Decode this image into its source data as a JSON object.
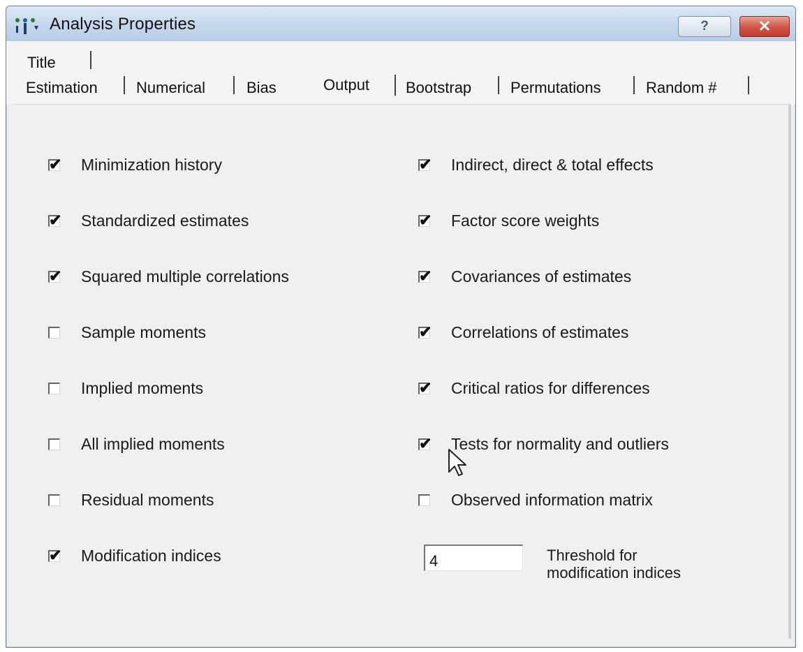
{
  "window": {
    "title": "Analysis Properties",
    "help_label": "?",
    "close_label": "✕"
  },
  "tabs": {
    "row1": [
      {
        "label": "Title"
      }
    ],
    "row2": [
      {
        "label": "Estimation"
      },
      {
        "label": "Numerical"
      },
      {
        "label": "Bias"
      },
      {
        "label": "Output",
        "selected": true
      },
      {
        "label": "Bootstrap"
      },
      {
        "label": "Permutations"
      },
      {
        "label": "Random #"
      }
    ]
  },
  "left_options": [
    {
      "label": "Minimization history",
      "checked": true
    },
    {
      "label": "Standardized estimates",
      "checked": true
    },
    {
      "label": "Squared multiple correlations",
      "checked": true
    },
    {
      "label": "Sample moments",
      "checked": false
    },
    {
      "label": "Implied moments",
      "checked": false
    },
    {
      "label": "All implied moments",
      "checked": false
    },
    {
      "label": "Residual moments",
      "checked": false
    },
    {
      "label": "Modification indices",
      "checked": true
    }
  ],
  "right_options": [
    {
      "label": "Indirect, direct & total effects",
      "checked": true
    },
    {
      "label": "Factor score weights",
      "checked": true
    },
    {
      "label": "Covariances of estimates",
      "checked": true
    },
    {
      "label": "Correlations of estimates",
      "checked": true
    },
    {
      "label": "Critical ratios for differences",
      "checked": true
    },
    {
      "label": "Tests for normality and outliers",
      "checked": true
    },
    {
      "label": "Observed information matrix",
      "checked": false
    }
  ],
  "threshold": {
    "value": "4",
    "label_line1": "Threshold for",
    "label_line2": "modification indices"
  },
  "check_mark": "✔",
  "colors": {
    "titlebar": "#c4d7ec",
    "close_button": "#c03a2a",
    "dialog_background": "#f0f0f0"
  }
}
